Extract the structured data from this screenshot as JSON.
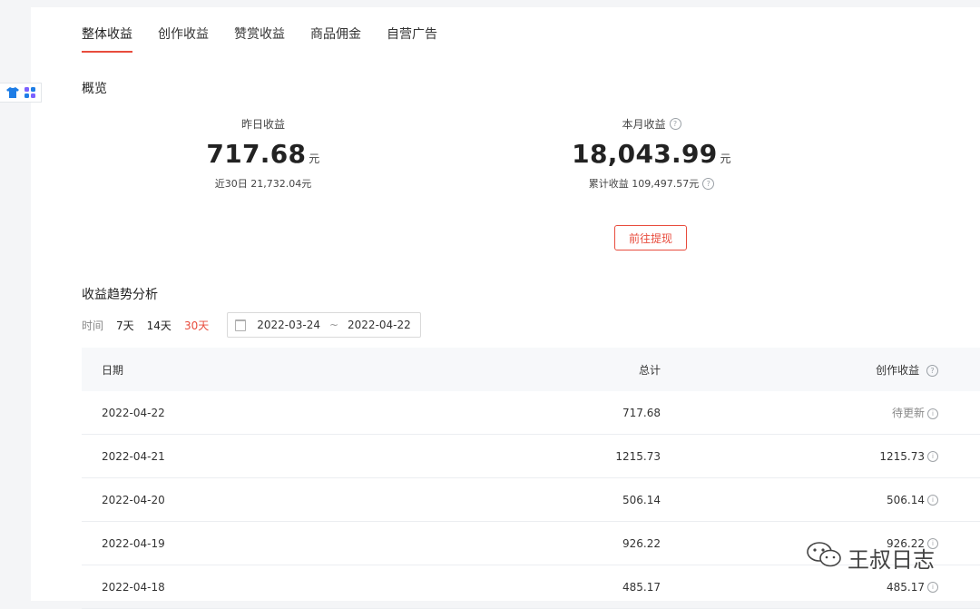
{
  "tabs": [
    "整体收益",
    "创作收益",
    "赞赏收益",
    "商品佣金",
    "自营广告"
  ],
  "overview": {
    "title": "概览",
    "yesterday": {
      "label": "昨日收益",
      "value": "717.68",
      "unit": "元",
      "sub": "近30日 21,732.04元"
    },
    "month": {
      "label": "本月收益",
      "value": "18,043.99",
      "unit": "元",
      "sub": "累计收益 109,497.57元"
    },
    "withdraw_label": "前往提现"
  },
  "trend": {
    "title": "收益趋势分析",
    "time_label": "时间",
    "ranges": [
      "7天",
      "14天",
      "30天"
    ],
    "active_range": "30天",
    "start_date": "2022-03-24",
    "end_date": "2022-04-22",
    "separator": "~"
  },
  "table": {
    "headers": {
      "date": "日期",
      "total": "总计",
      "creation": "创作收益"
    },
    "rows": [
      {
        "date": "2022-04-22",
        "total": "717.68",
        "creation": "待更新"
      },
      {
        "date": "2022-04-21",
        "total": "1215.73",
        "creation": "1215.73"
      },
      {
        "date": "2022-04-20",
        "total": "506.14",
        "creation": "506.14"
      },
      {
        "date": "2022-04-19",
        "total": "926.22",
        "creation": "926.22"
      },
      {
        "date": "2022-04-18",
        "total": "485.17",
        "creation": "485.17"
      }
    ]
  },
  "watermark": "王叔日志",
  "colors": {
    "accent": "#e84c3d",
    "widget_blue": "#1e7de6",
    "widget_purple": "#7b61ff"
  }
}
